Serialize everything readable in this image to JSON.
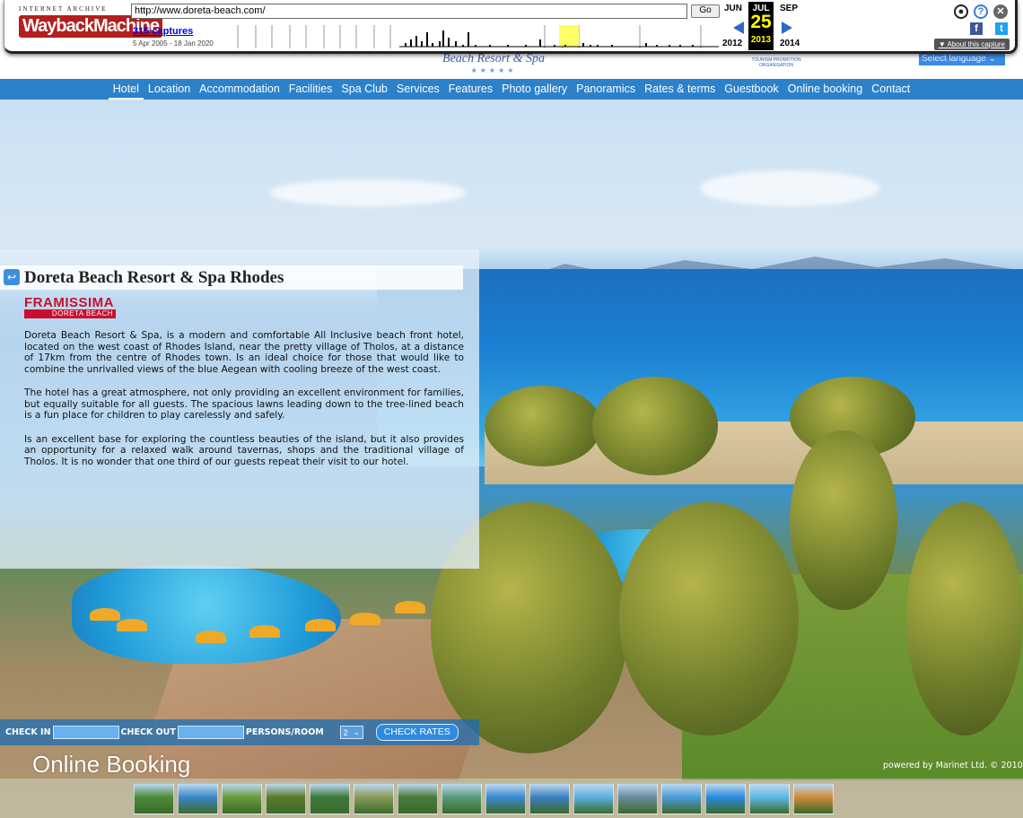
{
  "wayback": {
    "logo_top": "INTERNET ARCHIVE",
    "logo_main": "WaybackMachine",
    "url": "http://www.doreta-beach.com/",
    "go_label": "Go",
    "captures": "315 captures",
    "range": "5 Apr 2005 - 18 Jan 2020",
    "prev_month": "JUN",
    "cur_month": "JUL",
    "next_month": "SEP",
    "cur_day": "25",
    "prev_year": "2012",
    "cur_year": "2013",
    "next_year": "2014",
    "about": "About this capture"
  },
  "site": {
    "logo_text": "Beach Resort & Spa",
    "stars": "★★★★★",
    "tpo_text": "TOURISM PROMOTION ORGANISATION",
    "language": "Select language"
  },
  "nav": {
    "items": [
      "Hotel",
      "Location",
      "Accommodation",
      "Facilities",
      "Spa Club",
      "Services",
      "Features",
      "Photo gallery",
      "Panoramics",
      "Rates & terms",
      "Guestbook",
      "Online booking",
      "Contact"
    ]
  },
  "panel": {
    "title": "Doreta Beach Resort & Spa Rhodes",
    "brand": "FRAMISSIMA",
    "brand_sub": "DORETA BEACH",
    "paragraphs": [
      "Doreta Beach Resort & Spa, is a modern and comfortable All Inclusive beach front hotel, located on the west coast of Rhodes Island, near the pretty village of Tholos, at a distance of 17km from the centre of Rhodes town. Is an ideal choice for those that would like to combine the unrivalled views of the blue Aegean with cooling breeze of the west coast.",
      "The hotel has a great atmosphere, not only providing an excellent environment for families, but equally suitable for all guests. The spacious lawns leading down to the tree-lined beach is a fun place for children to play carelessly and safely.",
      "Is an excellent base for exploring the countless beauties of the island, but it also provides an opportunity for a relaxed walk around tavernas, shops and the traditional village of Tholos. It is no wonder that one third of our guests repeat their visit to our hotel."
    ]
  },
  "booking": {
    "check_in": "CHECK IN",
    "check_out": "CHECK OUT",
    "persons": "PERSONS/ROOM",
    "persons_value": "2",
    "button": "CHECK RATES",
    "title": "Online Booking",
    "powered": "powered by Marinet Ltd. © 2010"
  },
  "thumbnails": {
    "count": 16,
    "colors": [
      "#4a8a3a",
      "#3b86c8",
      "#6b9a3c",
      "#5a7a2a",
      "#3d7a3a",
      "#8a9a5a",
      "#4a7a3a",
      "#5a9a7a",
      "#3a8ad0",
      "#3b80c0",
      "#5ab0e0",
      "#6a8aa0",
      "#4a9ad8",
      "#2a8ae0",
      "#5ab8e8",
      "#d08a3a"
    ]
  }
}
